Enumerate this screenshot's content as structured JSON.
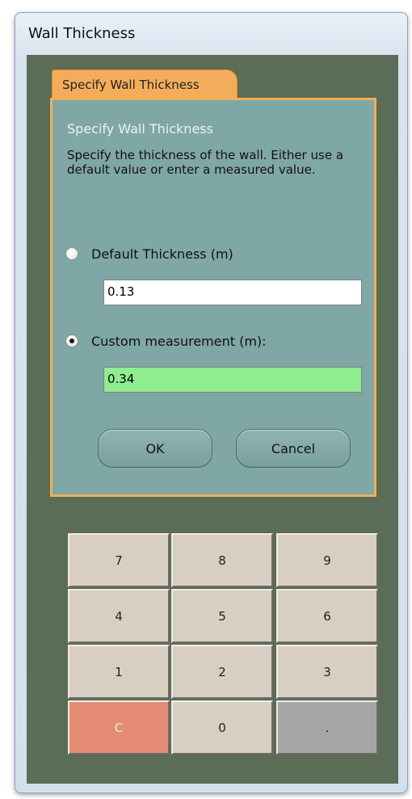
{
  "window": {
    "title": "Wall Thickness"
  },
  "tab": {
    "label": "Specify Wall Thickness"
  },
  "panel": {
    "heading": "Specify Wall Thickness",
    "description": "Specify the thickness of the wall. Either use a default value or enter a measured value."
  },
  "options": {
    "default_label": "Default Thickness (m)",
    "default_value": "0.13",
    "default_selected": false,
    "custom_label": "Custom measurement (m):",
    "custom_value": "0.34",
    "custom_selected": true
  },
  "buttons": {
    "ok": "OK",
    "cancel": "Cancel"
  },
  "keypad": {
    "keys": [
      "7",
      "8",
      "9",
      "4",
      "5",
      "6",
      "1",
      "2",
      "3",
      "C",
      "0",
      "."
    ]
  },
  "colors": {
    "background": "#5b6c57",
    "panel": "#7fa7a5",
    "tab": "#f3ad5a",
    "custom_field": "#8fee8f",
    "clear_key": "#e38b73",
    "decimal_key": "#a6a6a6"
  }
}
